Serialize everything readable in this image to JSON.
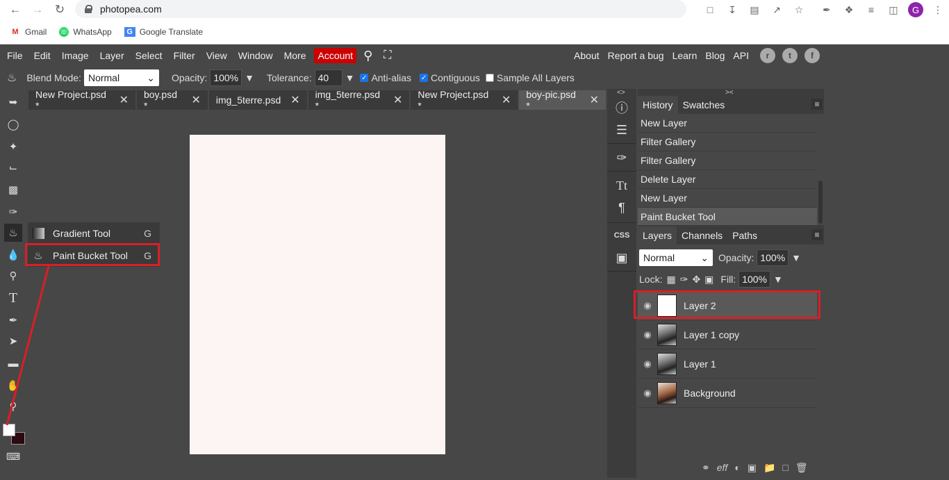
{
  "browser": {
    "url": "photopea.com",
    "avatar_letter": "G",
    "bookmarks": [
      {
        "label": "Gmail"
      },
      {
        "label": "WhatsApp"
      },
      {
        "label": "Google Translate"
      }
    ]
  },
  "menu": {
    "items": [
      "File",
      "Edit",
      "Image",
      "Layer",
      "Select",
      "Filter",
      "View",
      "Window",
      "More"
    ],
    "account": "Account",
    "right": [
      "About",
      "Report a bug",
      "Learn",
      "Blog",
      "API"
    ]
  },
  "options": {
    "blend_label": "Blend Mode:",
    "blend_value": "Normal",
    "opacity_label": "Opacity:",
    "opacity_value": "100%",
    "tolerance_label": "Tolerance:",
    "tolerance_value": "40",
    "antialias": "Anti-alias",
    "contiguous": "Contiguous",
    "sample_all": "Sample All Layers"
  },
  "tabs": [
    {
      "label": "New Project.psd *"
    },
    {
      "label": "boy.psd *"
    },
    {
      "label": "img_5terre.psd"
    },
    {
      "label": "img_5terre.psd *"
    },
    {
      "label": "New Project.psd *"
    },
    {
      "label": "boy-pic.psd *"
    }
  ],
  "flyout": {
    "gradient": {
      "label": "Gradient Tool",
      "key": "G"
    },
    "bucket": {
      "label": "Paint Bucket Tool",
      "key": "G"
    }
  },
  "history": {
    "tabs": [
      "History",
      "Swatches"
    ],
    "items": [
      "New Layer",
      "Filter Gallery",
      "Filter Gallery",
      "Delete Layer",
      "New Layer",
      "Paint Bucket Tool"
    ]
  },
  "layers": {
    "tabs": [
      "Layers",
      "Channels",
      "Paths"
    ],
    "blend": "Normal",
    "opacity_label": "Opacity:",
    "opacity_value": "100%",
    "lock_label": "Lock:",
    "fill_label": "Fill:",
    "fill_value": "100%",
    "items": [
      {
        "name": "Layer 2"
      },
      {
        "name": "Layer 1 copy"
      },
      {
        "name": "Layer 1"
      },
      {
        "name": "Background"
      }
    ]
  },
  "colors": {
    "highlight": "#d91f26",
    "account": "#cc0000",
    "canvas": "#fcf5f4"
  }
}
